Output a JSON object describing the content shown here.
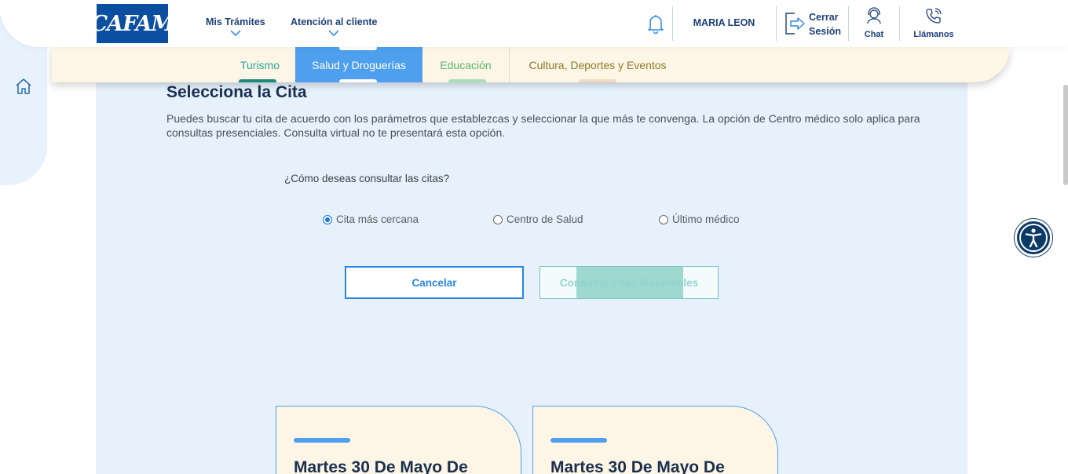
{
  "header": {
    "logo_text": "CAFAM",
    "nav": [
      {
        "label": "Mis Trámites"
      },
      {
        "label": "Atención al cliente"
      }
    ],
    "user_name": "MARIA LEON",
    "logout_label_1": "Cerrar",
    "logout_label_2": "Sesión",
    "chat_label": "Chat",
    "call_label": "Llámanos"
  },
  "tabs": [
    {
      "label": "Turismo",
      "color": "#2aa59a",
      "bar_color": "#1e8a7c"
    },
    {
      "label": "Salud y Droguerías",
      "color": "#ffffff",
      "active": true
    },
    {
      "label": "Educación",
      "color": "#55b86c",
      "bar_color": "#a8deb3"
    },
    {
      "label": "Cultura, Deportes y Eventos",
      "color": "#8d7a2a",
      "bar_color": "#efdcc0"
    }
  ],
  "section": {
    "title": "Selecciona la Cita",
    "description": "Puedes buscar tu cita de acuerdo con los parámetros que establezcas y seleccionar la que más te convenga. La opción de Centro médico solo aplica para consultas presenciales. Consulta virtual no te presentará esta opción.",
    "question": "¿Cómo deseas consultar las citas?",
    "options": [
      {
        "label": "Cita más cercana",
        "checked": true
      },
      {
        "label": "Centro de Salud",
        "checked": false
      },
      {
        "label": "Último médico",
        "checked": false
      }
    ],
    "cancel_label": "Cancelar",
    "consult_label": "Consultar citas disponibles"
  },
  "cards": [
    {
      "date": "Martes 30 De Mayo De"
    },
    {
      "date": "Martes 30 De Mayo De"
    }
  ],
  "colors": {
    "accent": "#4e9fed",
    "navy": "#1c3f7a",
    "panel": "#e6f1fc"
  },
  "icons": [
    "home-icon",
    "bell-icon",
    "logout-icon",
    "chat-agent-icon",
    "phone-icon",
    "accessibility-icon",
    "chevron-down-icon"
  ]
}
